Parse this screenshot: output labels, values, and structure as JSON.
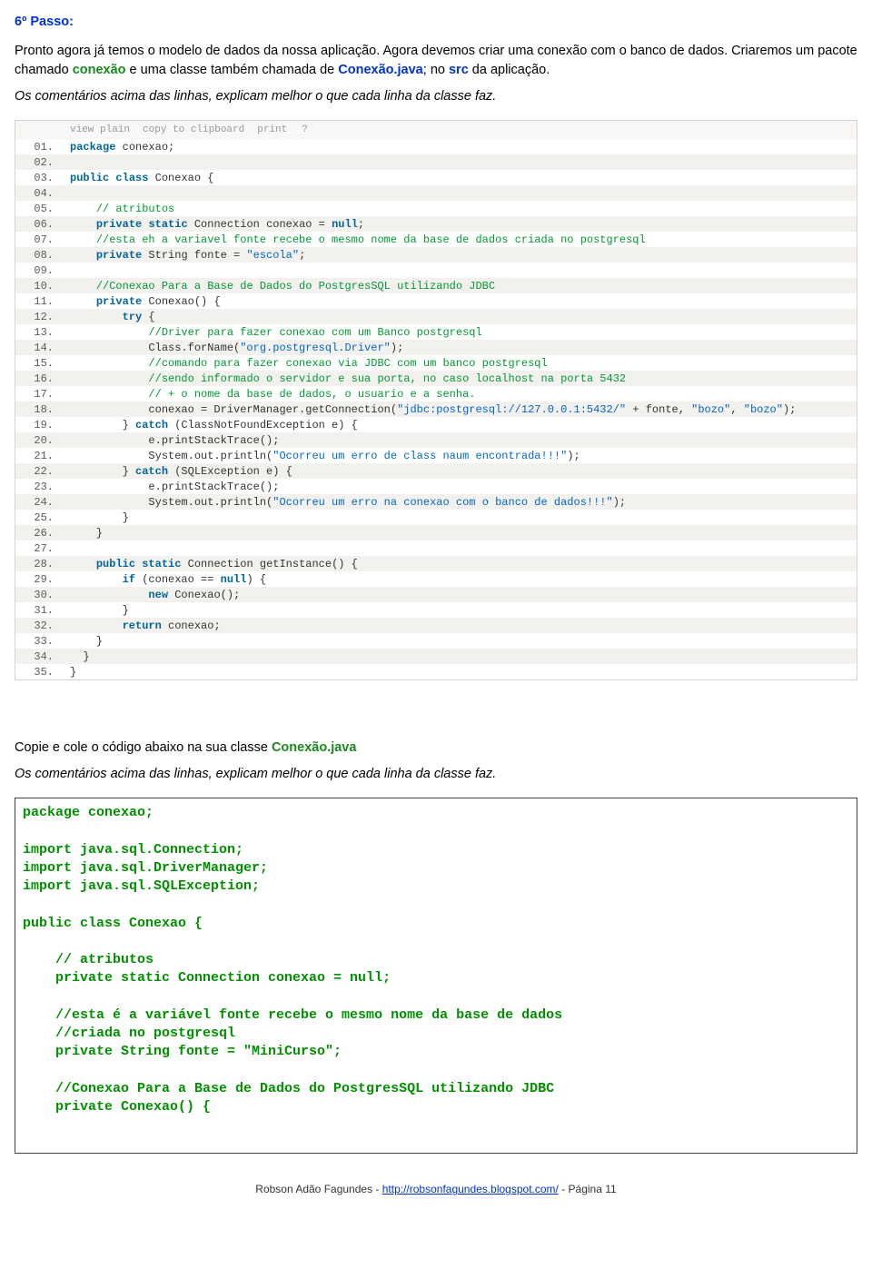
{
  "stepHeading": "6º Passo:",
  "intro": {
    "t1": "Pronto agora já temos o modelo de dados da nossa aplicação. Agora devemos criar uma conexão com o banco de dados.  Criaremos um pacote chamado ",
    "pkg": "conexão",
    "t2": " e uma classe também chamada de ",
    "cls": "Conexão.java",
    "t3": ";  no ",
    "src": "src",
    "t4": " da aplicação."
  },
  "commentNote": "Os comentários acima das linhas, explicam melhor o que cada linha da classe faz.",
  "toolbar": {
    "viewPlain": "view plain",
    "copy": "copy to clipboard",
    "print": "print",
    "q": "?"
  },
  "code": [
    {
      "n": "01.",
      "frags": [
        {
          "c": "kw",
          "t": "package"
        },
        {
          "c": "plain",
          "t": " conexao;"
        }
      ]
    },
    {
      "n": "02.",
      "frags": []
    },
    {
      "n": "03.",
      "frags": [
        {
          "c": "kw",
          "t": "public"
        },
        {
          "c": "plain",
          "t": " "
        },
        {
          "c": "kw",
          "t": "class"
        },
        {
          "c": "plain",
          "t": " Conexao {"
        }
      ]
    },
    {
      "n": "04.",
      "frags": []
    },
    {
      "n": "05.",
      "frags": [
        {
          "c": "plain",
          "t": "    "
        },
        {
          "c": "com",
          "t": "// atributos"
        }
      ]
    },
    {
      "n": "06.",
      "frags": [
        {
          "c": "plain",
          "t": "    "
        },
        {
          "c": "kw",
          "t": "private"
        },
        {
          "c": "plain",
          "t": " "
        },
        {
          "c": "kw",
          "t": "static"
        },
        {
          "c": "plain",
          "t": " Connection conexao = "
        },
        {
          "c": "kw",
          "t": "null"
        },
        {
          "c": "plain",
          "t": ";"
        }
      ]
    },
    {
      "n": "07.",
      "frags": [
        {
          "c": "plain",
          "t": "    "
        },
        {
          "c": "com",
          "t": "//esta eh a variavel fonte recebe o mesmo nome da base de dados criada no postgresql"
        }
      ]
    },
    {
      "n": "08.",
      "frags": [
        {
          "c": "plain",
          "t": "    "
        },
        {
          "c": "kw",
          "t": "private"
        },
        {
          "c": "plain",
          "t": " String fonte = "
        },
        {
          "c": "str",
          "t": "\"escola\""
        },
        {
          "c": "plain",
          "t": ";"
        }
      ]
    },
    {
      "n": "09.",
      "frags": []
    },
    {
      "n": "10.",
      "frags": [
        {
          "c": "plain",
          "t": "    "
        },
        {
          "c": "com",
          "t": "//Conexao Para a Base de Dados do PostgresSQL utilizando JDBC"
        }
      ]
    },
    {
      "n": "11.",
      "frags": [
        {
          "c": "plain",
          "t": "    "
        },
        {
          "c": "kw",
          "t": "private"
        },
        {
          "c": "plain",
          "t": " Conexao() {"
        }
      ]
    },
    {
      "n": "12.",
      "frags": [
        {
          "c": "plain",
          "t": "        "
        },
        {
          "c": "kw",
          "t": "try"
        },
        {
          "c": "plain",
          "t": " {"
        }
      ]
    },
    {
      "n": "13.",
      "frags": [
        {
          "c": "plain",
          "t": "            "
        },
        {
          "c": "com",
          "t": "//Driver para fazer conexao com um Banco postgresql"
        }
      ]
    },
    {
      "n": "14.",
      "frags": [
        {
          "c": "plain",
          "t": "            Class.forName("
        },
        {
          "c": "str",
          "t": "\"org.postgresql.Driver\""
        },
        {
          "c": "plain",
          "t": ");"
        }
      ]
    },
    {
      "n": "15.",
      "frags": [
        {
          "c": "plain",
          "t": "            "
        },
        {
          "c": "com",
          "t": "//comando para fazer conexao via JDBC com um banco postgresql"
        }
      ]
    },
    {
      "n": "16.",
      "frags": [
        {
          "c": "plain",
          "t": "            "
        },
        {
          "c": "com",
          "t": "//sendo informado o servidor e sua porta, no caso localhost na porta 5432"
        }
      ]
    },
    {
      "n": "17.",
      "frags": [
        {
          "c": "plain",
          "t": "            "
        },
        {
          "c": "com",
          "t": "// + o nome da base de dados, o usuario e a senha."
        }
      ]
    },
    {
      "n": "18.",
      "frags": [
        {
          "c": "plain",
          "t": "            conexao = DriverManager.getConnection("
        },
        {
          "c": "str",
          "t": "\"jdbc:postgresql://127.0.0.1:5432/\""
        },
        {
          "c": "plain",
          "t": " + fonte, "
        },
        {
          "c": "str",
          "t": "\"bozo\""
        },
        {
          "c": "plain",
          "t": ", "
        },
        {
          "c": "str",
          "t": "\"bozo\""
        },
        {
          "c": "plain",
          "t": ");"
        }
      ]
    },
    {
      "n": "19.",
      "frags": [
        {
          "c": "plain",
          "t": "        } "
        },
        {
          "c": "kw",
          "t": "catch"
        },
        {
          "c": "plain",
          "t": " (ClassNotFoundException e) {"
        }
      ]
    },
    {
      "n": "20.",
      "frags": [
        {
          "c": "plain",
          "t": "            e.printStackTrace();"
        }
      ]
    },
    {
      "n": "21.",
      "frags": [
        {
          "c": "plain",
          "t": "            System.out.println("
        },
        {
          "c": "str",
          "t": "\"Ocorreu um erro de class naum encontrada!!!\""
        },
        {
          "c": "plain",
          "t": ");"
        }
      ]
    },
    {
      "n": "22.",
      "frags": [
        {
          "c": "plain",
          "t": "        } "
        },
        {
          "c": "kw",
          "t": "catch"
        },
        {
          "c": "plain",
          "t": " (SQLException e) {"
        }
      ]
    },
    {
      "n": "23.",
      "frags": [
        {
          "c": "plain",
          "t": "            e.printStackTrace();"
        }
      ]
    },
    {
      "n": "24.",
      "frags": [
        {
          "c": "plain",
          "t": "            System.out.println("
        },
        {
          "c": "str",
          "t": "\"Ocorreu um erro na conexao com o banco de dados!!!\""
        },
        {
          "c": "plain",
          "t": ");"
        }
      ]
    },
    {
      "n": "25.",
      "frags": [
        {
          "c": "plain",
          "t": "        }"
        }
      ]
    },
    {
      "n": "26.",
      "frags": [
        {
          "c": "plain",
          "t": "    }"
        }
      ]
    },
    {
      "n": "27.",
      "frags": []
    },
    {
      "n": "28.",
      "frags": [
        {
          "c": "plain",
          "t": "    "
        },
        {
          "c": "kw",
          "t": "public"
        },
        {
          "c": "plain",
          "t": " "
        },
        {
          "c": "kw",
          "t": "static"
        },
        {
          "c": "plain",
          "t": " Connection getInstance() {"
        }
      ]
    },
    {
      "n": "29.",
      "frags": [
        {
          "c": "plain",
          "t": "        "
        },
        {
          "c": "kw",
          "t": "if"
        },
        {
          "c": "plain",
          "t": " (conexao == "
        },
        {
          "c": "kw",
          "t": "null"
        },
        {
          "c": "plain",
          "t": ") {"
        }
      ]
    },
    {
      "n": "30.",
      "frags": [
        {
          "c": "plain",
          "t": "            "
        },
        {
          "c": "kw",
          "t": "new"
        },
        {
          "c": "plain",
          "t": " Conexao();"
        }
      ]
    },
    {
      "n": "31.",
      "frags": [
        {
          "c": "plain",
          "t": "        }"
        }
      ]
    },
    {
      "n": "32.",
      "frags": [
        {
          "c": "plain",
          "t": "        "
        },
        {
          "c": "kw",
          "t": "return"
        },
        {
          "c": "plain",
          "t": " conexao;"
        }
      ]
    },
    {
      "n": "33.",
      "frags": [
        {
          "c": "plain",
          "t": "    }"
        }
      ]
    },
    {
      "n": "34.",
      "frags": [
        {
          "c": "plain",
          "t": "  }"
        }
      ]
    },
    {
      "n": "35.",
      "frags": [
        {
          "c": "plain",
          "t": "}"
        }
      ]
    }
  ],
  "copyPaste": {
    "pre": "Copie e cole o código abaixo na sua classe ",
    "cls": "Conexão.java"
  },
  "code2": "package conexao;\n\nimport java.sql.Connection;\nimport java.sql.DriverManager;\nimport java.sql.SQLException;\n\npublic class Conexao {\n\n    // atributos\n    private static Connection conexao = null;\n\n    //esta é a variável fonte recebe o mesmo nome da base de dados\n    //criada no postgresql\n    private String fonte = \"MiniCurso\";\n\n    //Conexao Para a Base de Dados do PostgresSQL utilizando JDBC\n    private Conexao() {",
  "footer": {
    "author": "Robson Adão Fagundes - ",
    "url": "http://robsonfagundes.blogspot.com/",
    "pageLabel": " - Página 11"
  }
}
